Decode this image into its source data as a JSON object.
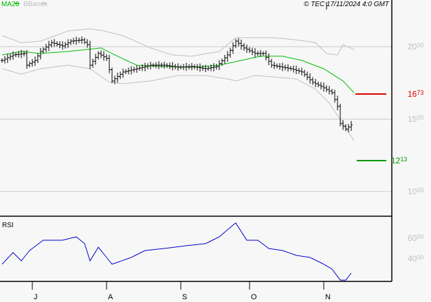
{
  "header": {
    "legend_ma": "MA20",
    "legend_bb": "BBands",
    "copyright": "© TEC 17/11/2024 4:0 GMT"
  },
  "colors": {
    "ma": "#00bb00",
    "bands": "#c0c0c0",
    "price": "#000000",
    "rsi": "#0000cc",
    "resistance": "#dd0000",
    "support": "#009900",
    "grid": "#c8c8c8",
    "axis_label": "#c0c0c0"
  },
  "chart_data": [
    {
      "type": "line",
      "title": "Price (OHLC bars) with MA20 and Bollinger Bands",
      "y_ticks": [
        {
          "value": 20,
          "label_main": "20",
          "label_sup": "00"
        },
        {
          "value": 15,
          "label_main": "15",
          "label_sup": "00"
        },
        {
          "value": 10,
          "label_main": "10",
          "label_sup": "00"
        }
      ],
      "ylim": [
        7.7,
        23.2
      ],
      "x_bars": 128,
      "x_ticks": [
        {
          "label": "J",
          "bar": 11
        },
        {
          "label": "A",
          "bar": 38
        },
        {
          "label": "S",
          "bar": 65
        },
        {
          "label": "O",
          "bar": 90
        },
        {
          "label": "N",
          "bar": 117
        }
      ],
      "close": [
        [
          0,
          19.05
        ],
        [
          4,
          19.43
        ],
        [
          8,
          19.53
        ],
        [
          9,
          18.72
        ],
        [
          12,
          19.05
        ],
        [
          14,
          19.67
        ],
        [
          18,
          20.28
        ],
        [
          22,
          20.05
        ],
        [
          25,
          20.38
        ],
        [
          29,
          20.47
        ],
        [
          31,
          20.14
        ],
        [
          32,
          18.72
        ],
        [
          35,
          19.53
        ],
        [
          38,
          19.19
        ],
        [
          40,
          17.63
        ],
        [
          44,
          18.25
        ],
        [
          49,
          18.48
        ],
        [
          54,
          18.72
        ],
        [
          59,
          18.72
        ],
        [
          64,
          18.58
        ],
        [
          69,
          18.63
        ],
        [
          74,
          18.48
        ],
        [
          78,
          18.63
        ],
        [
          82,
          19.43
        ],
        [
          85,
          20.38
        ],
        [
          88,
          19.91
        ],
        [
          92,
          19.53
        ],
        [
          95,
          19.53
        ],
        [
          98,
          18.72
        ],
        [
          102,
          18.58
        ],
        [
          105,
          18.48
        ],
        [
          109,
          18.25
        ],
        [
          113,
          17.54
        ],
        [
          117,
          17.16
        ],
        [
          120,
          16.82
        ],
        [
          122,
          15.88
        ],
        [
          123,
          14.69
        ],
        [
          125,
          14.31
        ],
        [
          127,
          14.6
        ]
      ],
      "ma20": [
        [
          0,
          19.43
        ],
        [
          7,
          19.67
        ],
        [
          14,
          19.53
        ],
        [
          24,
          19.67
        ],
        [
          36,
          19.91
        ],
        [
          42,
          19.34
        ],
        [
          49,
          18.72
        ],
        [
          59,
          18.63
        ],
        [
          69,
          18.58
        ],
        [
          79,
          18.72
        ],
        [
          87,
          19.05
        ],
        [
          94,
          19.34
        ],
        [
          102,
          19.34
        ],
        [
          109,
          19.05
        ],
        [
          117,
          18.48
        ],
        [
          124,
          17.63
        ],
        [
          128,
          16.82
        ]
      ],
      "bb_upper": [
        [
          0,
          20.76
        ],
        [
          7,
          20.28
        ],
        [
          14,
          20.38
        ],
        [
          24,
          21.09
        ],
        [
          32,
          21.23
        ],
        [
          37,
          21.09
        ],
        [
          44,
          20.76
        ],
        [
          54,
          19.91
        ],
        [
          62,
          19.43
        ],
        [
          69,
          19.34
        ],
        [
          79,
          19.67
        ],
        [
          85,
          20.62
        ],
        [
          89,
          20.62
        ],
        [
          99,
          20.62
        ],
        [
          107,
          20.47
        ],
        [
          114,
          20.28
        ],
        [
          118,
          19.53
        ],
        [
          122,
          19.43
        ],
        [
          124,
          20.14
        ],
        [
          128,
          19.81
        ]
      ],
      "bb_lower": [
        [
          0,
          18.48
        ],
        [
          7,
          18.1
        ],
        [
          14,
          18.48
        ],
        [
          24,
          18.72
        ],
        [
          32,
          18.48
        ],
        [
          39,
          17.54
        ],
        [
          44,
          17.44
        ],
        [
          54,
          17.63
        ],
        [
          64,
          18.01
        ],
        [
          74,
          18.01
        ],
        [
          82,
          17.77
        ],
        [
          85,
          17.63
        ],
        [
          92,
          18.01
        ],
        [
          99,
          17.91
        ],
        [
          107,
          17.77
        ],
        [
          114,
          17.06
        ],
        [
          119,
          16.11
        ],
        [
          124,
          14.69
        ],
        [
          128,
          13.51
        ]
      ],
      "levels": [
        {
          "name": "resistance",
          "value": 16.73,
          "label_main": "16",
          "label_sup": "73"
        },
        {
          "name": "support",
          "value": 12.13,
          "label_main": "12",
          "label_sup": "13"
        }
      ]
    },
    {
      "type": "line",
      "title": "RSI",
      "y_ticks": [
        {
          "value": 60,
          "label_main": "60",
          "label_sup": "00"
        },
        {
          "value": 40,
          "label_main": "40",
          "label_sup": "00"
        }
      ],
      "ylim": [
        1.3,
        81.3
      ],
      "rsi": [
        [
          0,
          34.7
        ],
        [
          4,
          46
        ],
        [
          7,
          38
        ],
        [
          10,
          48
        ],
        [
          15,
          58
        ],
        [
          22,
          58
        ],
        [
          27,
          61.3
        ],
        [
          30,
          54.7
        ],
        [
          32,
          38
        ],
        [
          35,
          51.3
        ],
        [
          40,
          34.7
        ],
        [
          47,
          41.3
        ],
        [
          52,
          48
        ],
        [
          59,
          50
        ],
        [
          67,
          52.7
        ],
        [
          74,
          54.7
        ],
        [
          79,
          61.3
        ],
        [
          84,
          72.7
        ],
        [
          85,
          74.7
        ],
        [
          89,
          58
        ],
        [
          93,
          58
        ],
        [
          97,
          50
        ],
        [
          102,
          48
        ],
        [
          107,
          43.3
        ],
        [
          112,
          41.3
        ],
        [
          117,
          34.7
        ],
        [
          120,
          30
        ],
        [
          123,
          19.3
        ],
        [
          125,
          19.3
        ],
        [
          127,
          26
        ]
      ]
    }
  ]
}
